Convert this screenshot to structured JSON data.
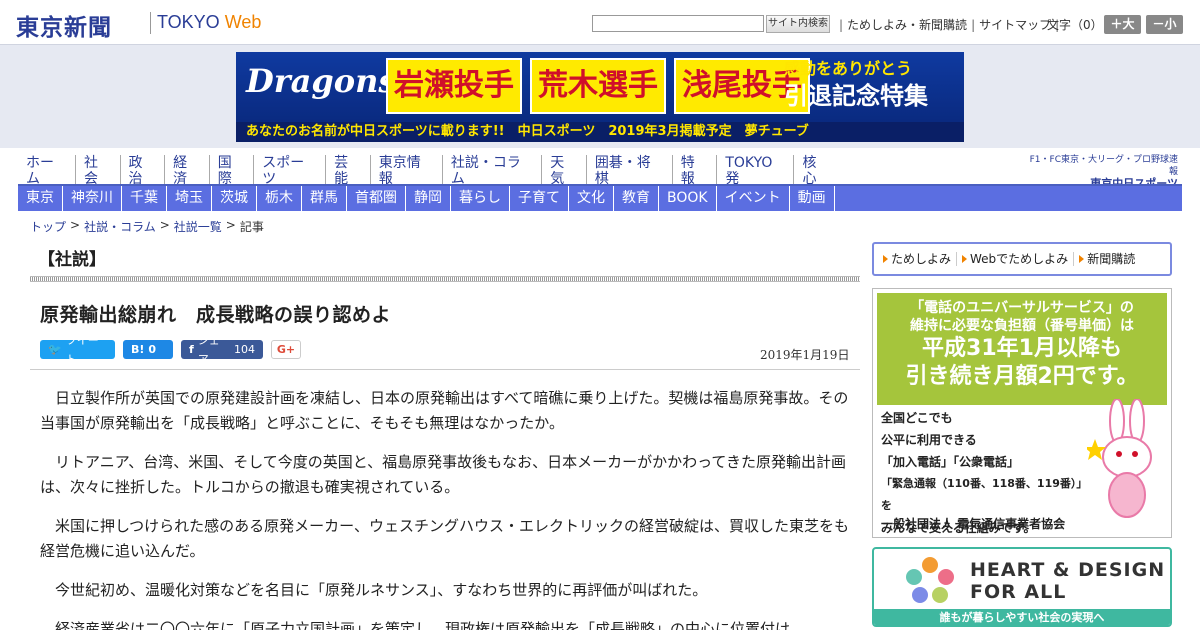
{
  "header": {
    "logo_jp": "東京新聞",
    "logo_en": "TOKYO ",
    "logo_web": "Web",
    "search_button": "サイト内検索",
    "links": [
      "ためしよみ・新聞購読",
      "サイトマップ"
    ],
    "font_size_label": "文字（0）",
    "font_larger": "＋大",
    "font_smaller": "－小"
  },
  "banner": {
    "logo": "Dragons",
    "names": [
      "岩瀬投手",
      "荒木選手",
      "浅尾投手"
    ],
    "right_line1": "感動をありがとう",
    "right_line2": "引退記念特集",
    "bottom": "あなたのお名前が中日スポーツに載ります!!　中日スポーツ　2019年3月掲載予定　夢チューブ"
  },
  "global_nav": [
    "ホーム",
    "社会",
    "政治",
    "経済",
    "国際",
    "スポーツ",
    "芸能",
    "東京情報",
    "社説・コラム",
    "天気",
    "囲碁・将棋",
    "特報",
    "TOKYO発",
    "核心"
  ],
  "sponsor": {
    "line1": "F1・FC東京・大リーグ・プロ野球速報",
    "line2": "東京中日スポーツ"
  },
  "local_nav": [
    "東京",
    "神奈川",
    "千葉",
    "埼玉",
    "茨城",
    "栃木",
    "群馬",
    "首都圏",
    "静岡",
    "暮らし",
    "子育て",
    "文化",
    "教育",
    "BOOK",
    "イベント",
    "動画"
  ],
  "breadcrumb": {
    "items": [
      "トップ",
      "社説・コラム",
      "社説一覧"
    ],
    "separator": ">",
    "current": "記事"
  },
  "article": {
    "section": "【社説】",
    "headline": "原発輸出総崩れ　成長戦略の誤り認めよ",
    "date": "2019年1月19日",
    "paragraphs": [
      "日立製作所が英国での原発建設計画を凍結し、日本の原発輸出はすべて暗礁に乗り上げた。契機は福島原発事故。その当事国が原発輸出を「成長戦略」と呼ぶことに、そもそも無理はなかったか。",
      "リトアニア、台湾、米国、そして今度の英国と、福島原発事故後もなお、日本メーカーがかかわってきた原発輸出計画は、次々に挫折した。トルコからの撤退も確実視されている。",
      "米国に押しつけられた感のある原発メーカー、ウェスチングハウス・エレクトリックの経営破綻は、買収した東芝をも経営危機に追い込んだ。",
      "今世紀初め、温暖化対策などを名目に「原発ルネサンス」、すなわち世界的に再評価が叫ばれた。",
      "経済産業省は二〇〇六年に「原子力立国計画」を策定し、現政権は原発輸出を「成長戦略」の中心に位置付け"
    ]
  },
  "social": {
    "tweet": "ツイート",
    "hatena": "B!",
    "hatena_count": "0",
    "share": "シェア",
    "share_count": "104",
    "gplus": "G+"
  },
  "sidebar": {
    "buttons": [
      "ためしよみ",
      "Webでためしよみ",
      "新聞購読"
    ],
    "ad1": {
      "line1": "「電話のユニバーサルサービス」の",
      "line2": "維持に必要な負担額（番号単価）は",
      "big1": "平成31年1月以降も",
      "big2": "引き続き月額2円です。",
      "body": [
        "全国どこでも",
        "公平に利用できる",
        "「加入電話」「公衆電話」",
        "「緊急通報（110番、118番、119番）」を",
        "みんなで支える仕組みです。"
      ],
      "org": "一般社団法人 電気通信事業者協会"
    },
    "ad2": {
      "title1": "HEART & DESIGN",
      "title2": "FOR ALL",
      "bottom": "誰もが暮らしやすい社会の実現へ"
    }
  },
  "colors": {
    "brand_blue": "#2a3d96",
    "local_nav_bg": "#5b6ee1",
    "web_orange": "#f08300"
  }
}
